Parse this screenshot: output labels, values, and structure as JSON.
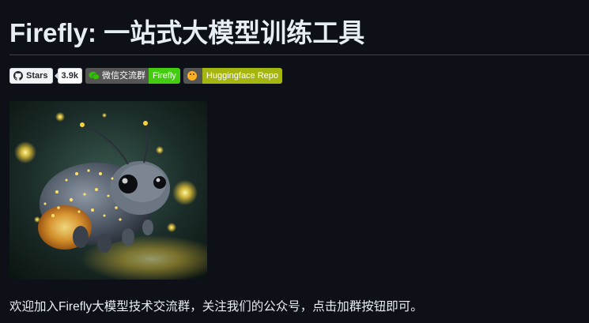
{
  "title": "Firefly: 一站式大模型训练工具",
  "badges": {
    "github": {
      "icon": "github-icon",
      "label": "Stars",
      "count": "3.9k"
    },
    "wechat": {
      "icon": "wechat-icon",
      "left": "微信交流群",
      "right": "Firefly",
      "color": "#44cc11"
    },
    "huggingface": {
      "icon": "huggingface-icon",
      "right": "Huggingface Repo",
      "color": "#a4b60f"
    }
  },
  "illustration": {
    "name": "firefly-creature-illustration"
  },
  "welcome_text": "欢迎加入Firefly大模型技术交流群，关注我们的公众号，点击加群按钮即可。"
}
